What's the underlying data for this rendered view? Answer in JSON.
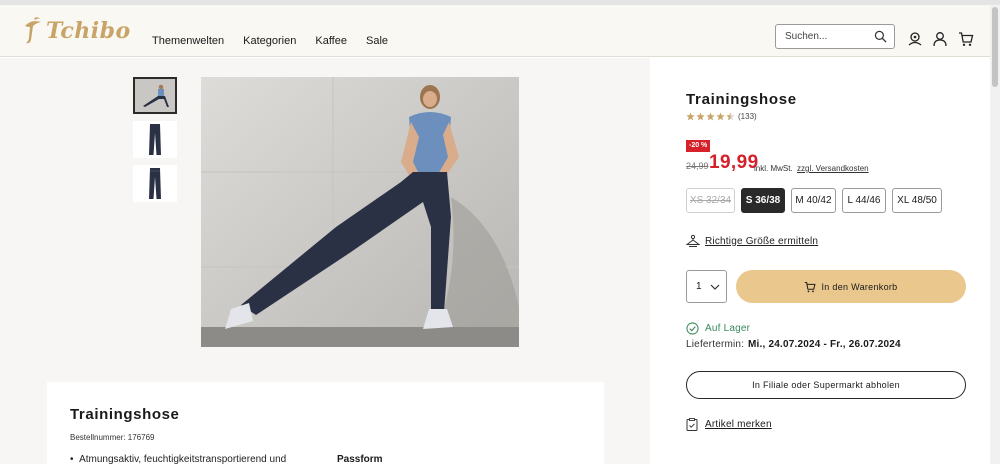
{
  "header": {
    "logo_text": "Tchibo",
    "nav": [
      "Themenwelten",
      "Kategorien",
      "Kaffee",
      "Sale"
    ],
    "search_placeholder": "Suchen..."
  },
  "gallery": {
    "thumbnails": [
      {
        "name": "thumb-model",
        "active": true
      },
      {
        "name": "thumb-pants-front",
        "active": false
      },
      {
        "name": "thumb-pants-back",
        "active": false
      }
    ]
  },
  "product": {
    "title": "Trainingshose",
    "rating": 4.5,
    "review_count": "(133)",
    "discount_badge": "-20 %",
    "old_price": "24,99",
    "price": "19,99",
    "vat_text": "inkl. MwSt.",
    "shipping_link": "zzgl. Versandkosten",
    "sizes": [
      {
        "label": "XS 32/34",
        "state": "disabled"
      },
      {
        "label": "S 36/38",
        "state": "selected"
      },
      {
        "label": "M 40/42",
        "state": "available"
      },
      {
        "label": "L 44/46",
        "state": "available"
      },
      {
        "label": "XL 48/50",
        "state": "available"
      }
    ],
    "size_finder_link": "Richtige Größe ermitteln",
    "quantity": "1",
    "add_to_cart": "In den Warenkorb",
    "stock_status": "Auf Lager",
    "delivery_label": "Liefertermin:",
    "delivery_date": "Mi., 24.07.2024 - Fr., 26.07.2024",
    "pickup_button": "In Filiale oder Supermarkt abholen",
    "wishlist_link": "Artikel merken"
  },
  "details": {
    "title": "Trainingshose",
    "order_number": "Bestellnummer: 176769",
    "bullet": "Atmungsaktiv, feuchtigkeitstransportierend und",
    "passform_heading": "Passform"
  },
  "colors": {
    "brand_gold": "#c9a468",
    "sale_red": "#d6202a",
    "cart_button": "#e9c78d",
    "stock_green": "#3a8a5a",
    "star": "#c9a468"
  }
}
